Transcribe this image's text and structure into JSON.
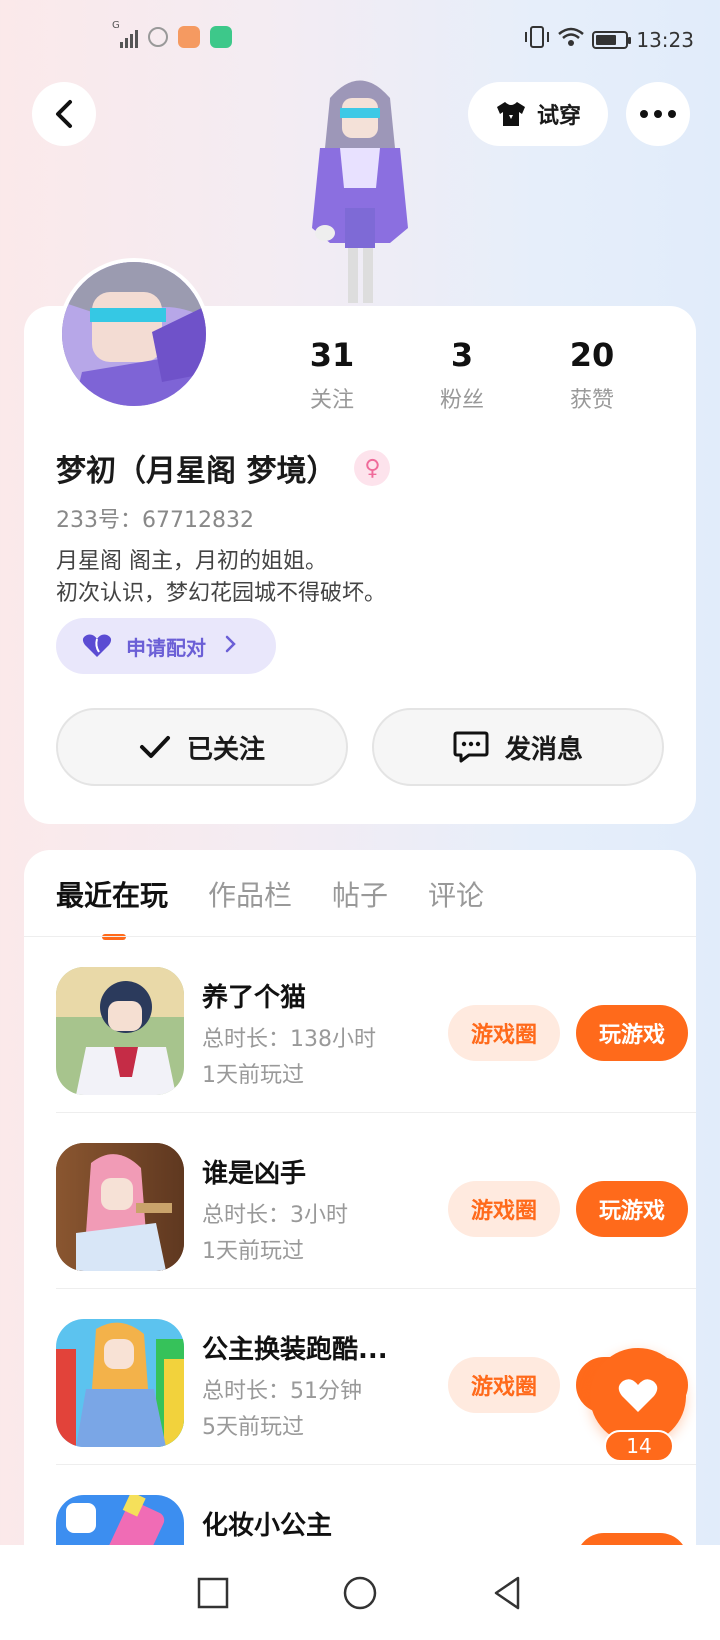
{
  "status_bar": {
    "time": "13:23",
    "network_label": "G"
  },
  "header": {
    "back_icon": "chevron-left-icon",
    "tryon_label": "试穿",
    "more_icon": "more-dots-icon"
  },
  "profile": {
    "stats": [
      {
        "value": "31",
        "label": "关注"
      },
      {
        "value": "3",
        "label": "粉丝"
      },
      {
        "value": "20",
        "label": "获赞"
      }
    ],
    "name": "梦初（月星阁 梦境）",
    "gender_symbol": "♀",
    "uid": "233号：67712832",
    "bio_line1": "月星阁 阁主，月初的姐姐。",
    "bio_line2": "初次认识，梦幻花园城不得破坏。",
    "pair_label": "申请配对",
    "follow_label": "已关注",
    "message_label": "发消息"
  },
  "tabs": [
    {
      "label": "最近在玩",
      "active": true
    },
    {
      "label": "作品栏",
      "active": false
    },
    {
      "label": "帖子",
      "active": false
    },
    {
      "label": "评论",
      "active": false
    }
  ],
  "games": [
    {
      "title": "养了个猫",
      "duration": "总时长：138小时",
      "last_played": "1天前玩过",
      "circle_label": "游戏圈",
      "play_label": "玩游戏"
    },
    {
      "title": "谁是凶手",
      "duration": "总时长：3小时",
      "last_played": "1天前玩过",
      "circle_label": "游戏圈",
      "play_label": "玩游戏"
    },
    {
      "title": "公主换装跑酷...",
      "duration": "总时长：51分钟",
      "last_played": "5天前玩过",
      "circle_label": "游戏圈",
      "play_label": "玩游戏"
    },
    {
      "title": "化妆小公主",
      "duration": "",
      "last_played": "",
      "circle_label": "",
      "play_label": ""
    }
  ],
  "like": {
    "count": "14"
  },
  "colors": {
    "accent": "#ff6a1b",
    "accent_light": "#ffeadf",
    "pair_bg": "#e9e7fb",
    "pair_text": "#6b5fd6"
  }
}
